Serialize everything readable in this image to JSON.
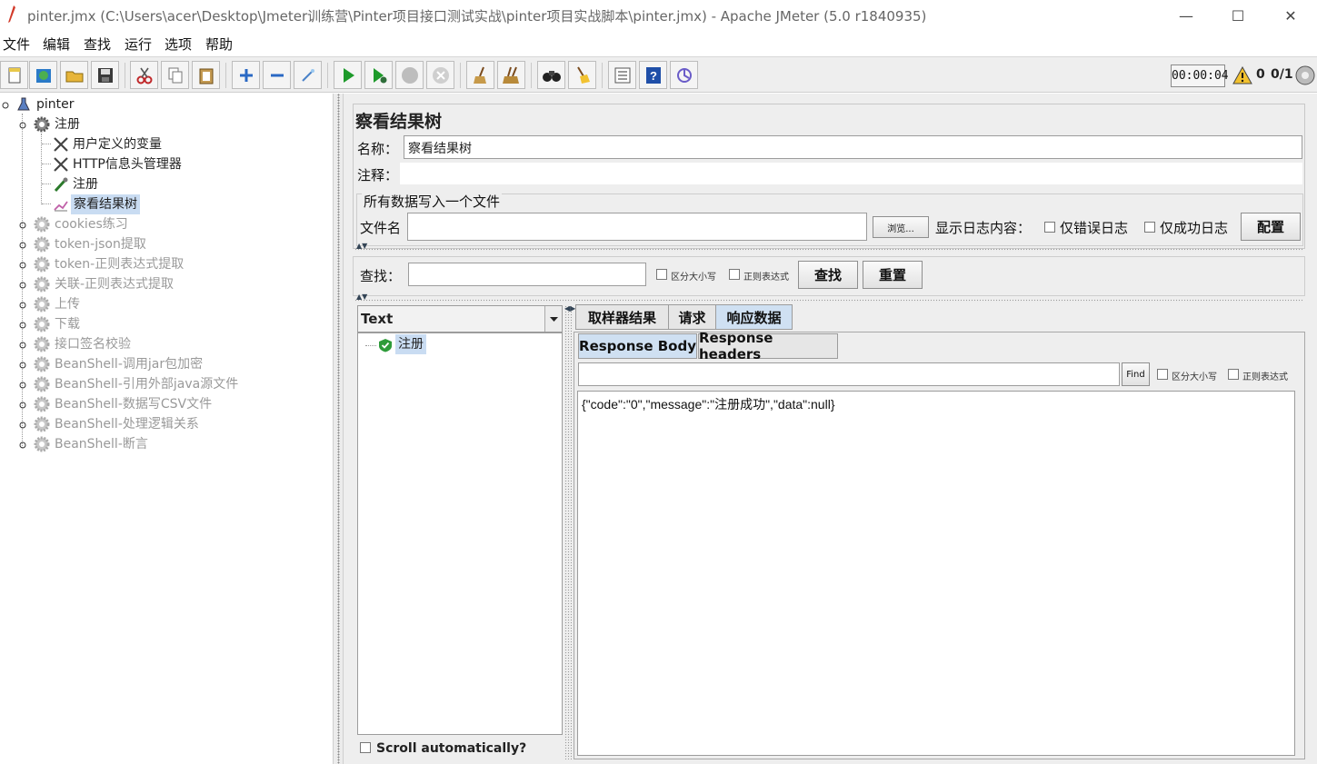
{
  "window": {
    "title": "pinter.jmx (C:\\Users\\acer\\Desktop\\Jmeter训练营\\Pinter项目接口测试实战\\pinter项目实战脚本\\pinter.jmx) - Apache JMeter (5.0 r1840935)",
    "minimize": "—",
    "maximize": "☐",
    "close": "✕"
  },
  "menu": [
    "文件",
    "编辑",
    "查找",
    "运行",
    "选项",
    "帮助"
  ],
  "status": {
    "elapsed": "00:00:04",
    "error_count": "0",
    "threads": "0/1"
  },
  "tree": {
    "root": "pinter",
    "group": "注册",
    "children": [
      "用户定义的变量",
      "HTTP信息头管理器",
      "注册",
      "察看结果树"
    ],
    "disabled_groups": [
      "cookies练习",
      "token-json提取",
      "token-正则表达式提取",
      "关联-正则表达式提取",
      "上传",
      "下载",
      "接口签名校验",
      "BeanShell-调用jar包加密",
      "BeanShell-引用外部java源文件",
      "BeanShell-数据写CSV文件",
      "BeanShell-处理逻辑关系",
      "BeanShell-断言"
    ]
  },
  "panel": {
    "title": "察看结果树",
    "name_label": "名称：",
    "name_value": "察看结果树",
    "comment_label": "注释：",
    "comment_value": "",
    "file_group_title": "所有数据写入一个文件",
    "filename_label": "文件名",
    "filename_value": "",
    "browse_button": "浏览...",
    "log_label": "显示日志内容：",
    "errors_only": "仅错误日志",
    "success_only": "仅成功日志",
    "configure_button": "配置",
    "search_label": "查找：",
    "search_value": "",
    "case_sensitive": "区分大小写",
    "regex": "正则表达式",
    "find_button": "查找",
    "reset_button": "重置"
  },
  "results": {
    "renderer": "Text",
    "sample_name": "注册",
    "scroll_auto": "Scroll automatically?",
    "tabs": [
      "取样器结果",
      "请求",
      "响应数据"
    ],
    "active_tab": "响应数据",
    "subtabs": [
      "Response Body",
      "Response headers"
    ],
    "body_find_button": "Find",
    "body_case_sensitive": "区分大小写",
    "body_regex": "正则表达式",
    "body_search_value": "",
    "response_body": "{\"code\":\"0\",\"message\":\"注册成功\",\"data\":null}"
  },
  "colors": {
    "selection": "#c9dcf2",
    "active_tab": "#cfe0f2",
    "disabled_text": "#999999",
    "run_green": "#1e9a2b"
  }
}
